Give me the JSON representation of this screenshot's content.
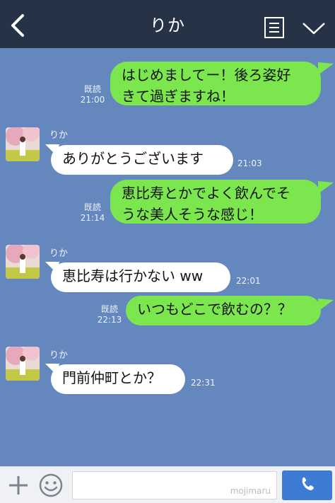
{
  "header": {
    "title": "りか",
    "back_icon": "chevron-left-icon",
    "menu_icon": "list-menu-icon",
    "dropdown_icon": "chevron-down-icon"
  },
  "messages": [
    {
      "side": "right",
      "lines": [
        "はじめましてー！後ろ姿好",
        "きて過ぎますね！"
      ],
      "read": "既読",
      "time": "21:00"
    },
    {
      "side": "left",
      "name": "りか",
      "lines": [
        "ありがとうございます"
      ],
      "time": "21:03"
    },
    {
      "side": "right",
      "lines": [
        "恵比寿とかでよく飲んでそ",
        "うな美人そうな感じ！"
      ],
      "read": "既読",
      "time": "21:14"
    },
    {
      "side": "left",
      "name": "りか",
      "lines": [
        "恵比寿は行かない ww"
      ],
      "time": "22:01"
    },
    {
      "side": "right",
      "lines": [
        "いつもどこで飲むの？？"
      ],
      "read": "既読",
      "time": "22:13"
    },
    {
      "side": "left",
      "name": "りか",
      "lines": [
        "門前仲町とか？"
      ],
      "time": "22:31"
    }
  ],
  "input_bar": {
    "watermark": "mojimaru",
    "plus_icon": "plus-icon",
    "emoji_icon": "smiley-icon",
    "call_icon": "phone-icon"
  },
  "colors": {
    "header": "#263347",
    "background": "#6487bd",
    "sent_bubble": "#7be64d",
    "received_bubble": "#ffffff",
    "call_button": "#3e7bd5"
  }
}
